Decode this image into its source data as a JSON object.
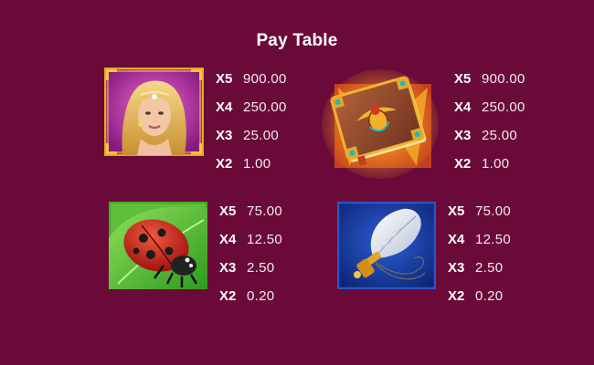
{
  "title": "Pay Table",
  "symbols": [
    {
      "name": "Queen",
      "icon": "queen-symbol-icon",
      "pays": [
        {
          "mult": "X5",
          "amount": "900.00"
        },
        {
          "mult": "X4",
          "amount": "250.00"
        },
        {
          "mult": "X3",
          "amount": "25.00"
        },
        {
          "mult": "X2",
          "amount": "1.00"
        }
      ]
    },
    {
      "name": "Book",
      "icon": "book-scarab-symbol-icon",
      "pays": [
        {
          "mult": "X5",
          "amount": "900.00"
        },
        {
          "mult": "X4",
          "amount": "250.00"
        },
        {
          "mult": "X3",
          "amount": "25.00"
        },
        {
          "mult": "X2",
          "amount": "1.00"
        }
      ]
    },
    {
      "name": "Ladybug",
      "icon": "ladybug-symbol-icon",
      "pays": [
        {
          "mult": "X5",
          "amount": "75.00"
        },
        {
          "mult": "X4",
          "amount": "12.50"
        },
        {
          "mult": "X3",
          "amount": "2.50"
        },
        {
          "mult": "X2",
          "amount": "0.20"
        }
      ]
    },
    {
      "name": "Feather",
      "icon": "feather-brush-symbol-icon",
      "pays": [
        {
          "mult": "X5",
          "amount": "75.00"
        },
        {
          "mult": "X4",
          "amount": "12.50"
        },
        {
          "mult": "X3",
          "amount": "2.50"
        },
        {
          "mult": "X2",
          "amount": "0.20"
        }
      ]
    }
  ],
  "colors": {
    "background": "#6a0a38",
    "text": "#ffffff",
    "gold": "#e8a71c",
    "green_frame": "#3fae2a",
    "blue_frame": "#2a56c8"
  }
}
